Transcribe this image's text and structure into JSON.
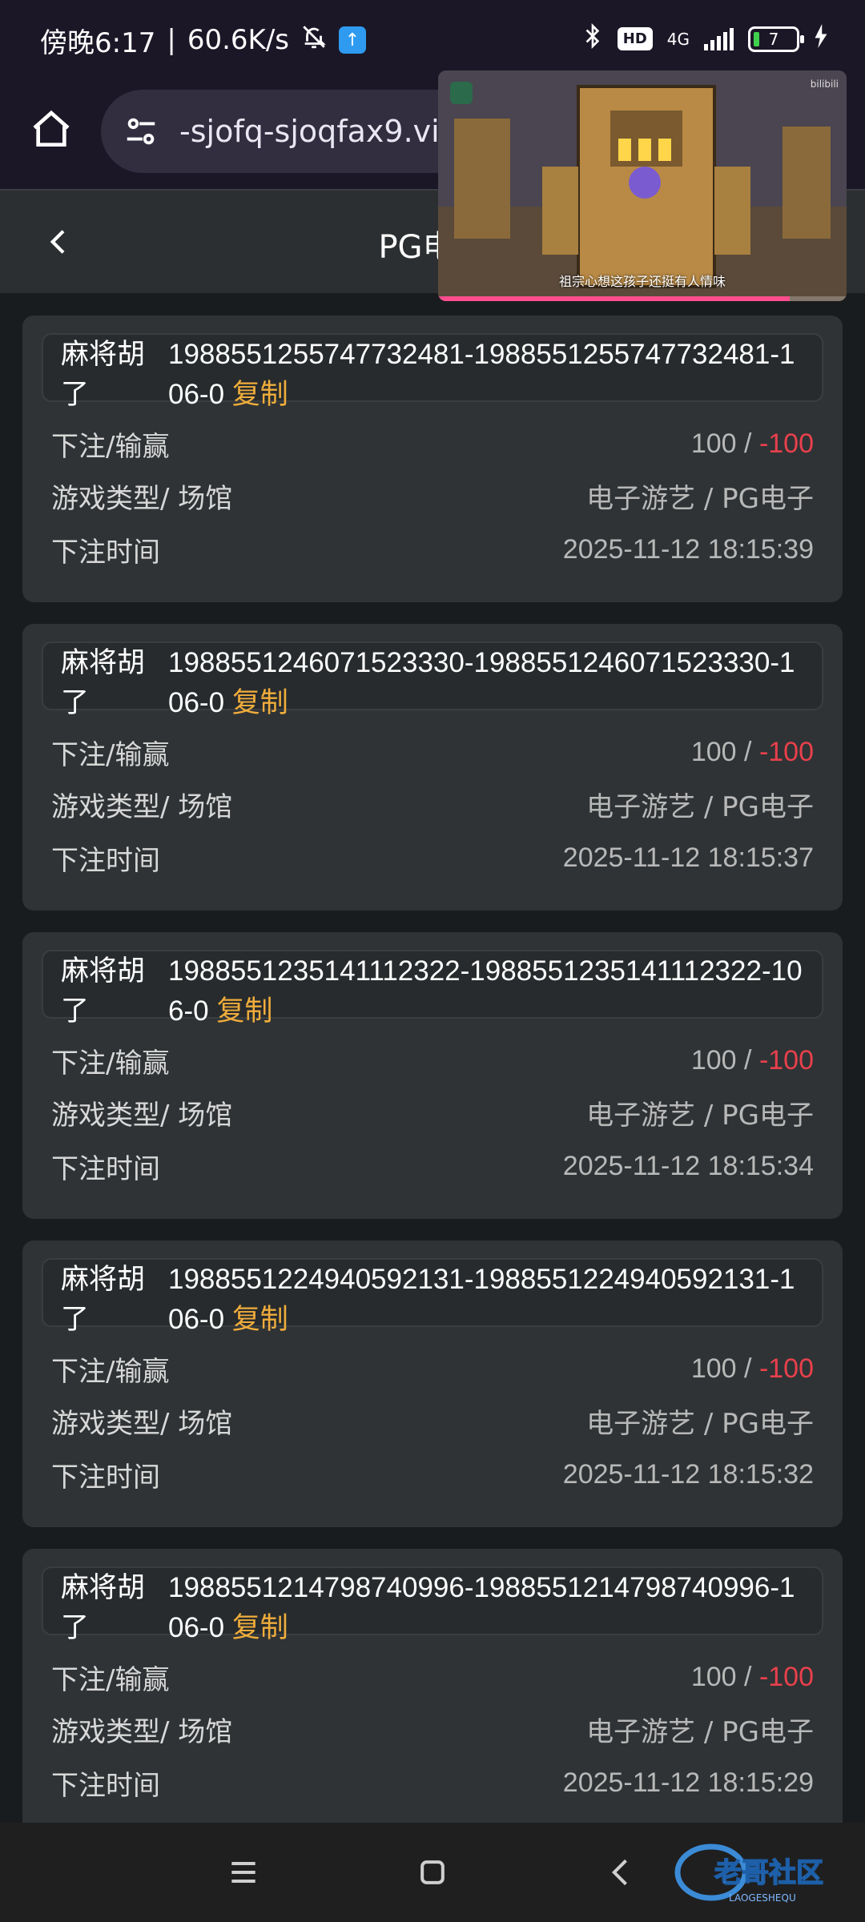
{
  "status": {
    "time": "傍晚6:17",
    "speed": "60.6K/s",
    "battery": "7",
    "network": "4G",
    "hd": "HD"
  },
  "browser": {
    "url": "-sjofq-sjoqfax9.vi"
  },
  "header": {
    "title": "PG电子"
  },
  "video": {
    "subtitle": "祖宗心想这孩子还挺有人情味",
    "watermark": "bilibili",
    "progress": 0.86
  },
  "labels": {
    "bet_win": "下注/输赢",
    "game_type": "游戏类型/ 场馆",
    "bet_time": "下注时间",
    "copy": "复制",
    "separator": " / "
  },
  "records": [
    {
      "name": "麻将胡了",
      "id": "1988551255747732481-1988551255747732481-106-0",
      "bet": "100",
      "win": "-100",
      "type": "电子游艺 / PG电子",
      "time": "2025-11-12 18:15:39"
    },
    {
      "name": "麻将胡了",
      "id": "1988551246071523330-1988551246071523330-106-0",
      "bet": "100",
      "win": "-100",
      "type": "电子游艺 / PG电子",
      "time": "2025-11-12 18:15:37"
    },
    {
      "name": "麻将胡了",
      "id": "1988551235141112322-1988551235141112322-106-0",
      "bet": "100",
      "win": "-100",
      "type": "电子游艺 / PG电子",
      "time": "2025-11-12 18:15:34"
    },
    {
      "name": "麻将胡了",
      "id": "1988551224940592131-1988551224940592131-106-0",
      "bet": "100",
      "win": "-100",
      "type": "电子游艺 / PG电子",
      "time": "2025-11-12 18:15:32"
    },
    {
      "name": "麻将胡了",
      "id": "1988551214798740996-1988551214798740996-106-0",
      "bet": "100",
      "win": "-100",
      "type": "电子游艺 / PG电子",
      "time": "2025-11-12 18:15:29"
    }
  ],
  "watermark_logo": "老哥社区 LAOGESHEQU",
  "colors": {
    "accent_copy": "#f0ad3c",
    "loss": "#e8404c",
    "card_bg": "#2f3335",
    "page_bg": "#191c1e"
  }
}
